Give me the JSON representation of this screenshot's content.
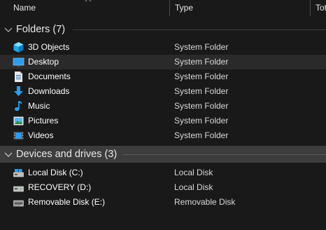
{
  "columns": {
    "name": "Name",
    "type": "Type",
    "total": "Tot"
  },
  "groups": [
    {
      "label": "Folders (7)",
      "items": [
        {
          "name": "3D Objects",
          "type": "System Folder",
          "icon": "3d-objects-icon"
        },
        {
          "name": "Desktop",
          "type": "System Folder",
          "icon": "desktop-icon"
        },
        {
          "name": "Documents",
          "type": "System Folder",
          "icon": "documents-icon"
        },
        {
          "name": "Downloads",
          "type": "System Folder",
          "icon": "downloads-icon"
        },
        {
          "name": "Music",
          "type": "System Folder",
          "icon": "music-icon"
        },
        {
          "name": "Pictures",
          "type": "System Folder",
          "icon": "pictures-icon"
        },
        {
          "name": "Videos",
          "type": "System Folder",
          "icon": "videos-icon"
        }
      ]
    },
    {
      "label": "Devices and drives (3)",
      "items": [
        {
          "name": "Local Disk (C:)",
          "type": "Local Disk",
          "icon": "local-disk-icon"
        },
        {
          "name": "RECOVERY (D:)",
          "type": "Local Disk",
          "icon": "recovery-disk-icon"
        },
        {
          "name": "Removable Disk (E:)",
          "type": "Removable Disk",
          "icon": "removable-disk-icon"
        }
      ]
    }
  ],
  "colors": {
    "background": "#191919",
    "selected_row": "#2a2a2a",
    "selected_group": "#3d3d3d",
    "folder_blue": "#2f9bea"
  }
}
